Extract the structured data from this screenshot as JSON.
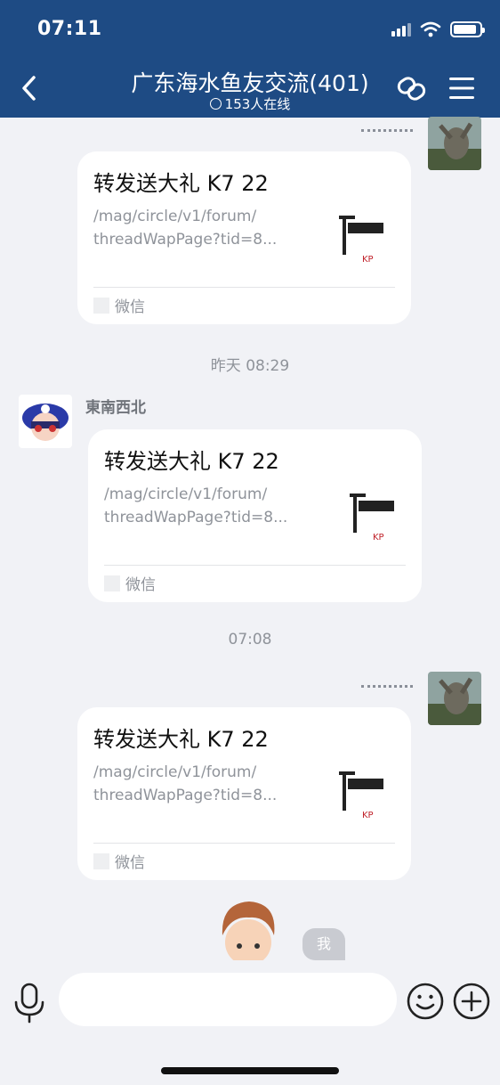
{
  "status_bar": {
    "time": "07:11"
  },
  "nav": {
    "title": "广东海水鱼友交流(401)",
    "online": "153人在线"
  },
  "messages": [
    {
      "title": "转发送大礼 K7 22",
      "desc_line1": "/mag/circle/v1/forum/",
      "desc_line2": "threadWapPage?tid=8...",
      "source": "微信"
    },
    {
      "time": "昨天 08:29",
      "sender": "東南西北",
      "title": "转发送大礼 K7 22",
      "desc_line1": "/mag/circle/v1/forum/",
      "desc_line2": "threadWapPage?tid=8...",
      "source": "微信"
    },
    {
      "time": "07:08",
      "title": "转发送大礼 K7 22",
      "desc_line1": "/mag/circle/v1/forum/",
      "desc_line2": "threadWapPage?tid=8...",
      "source": "微信"
    }
  ],
  "me_label": "我",
  "input": {
    "value": "",
    "placeholder": ""
  },
  "colors": {
    "nav_bg": "#1e4b84",
    "page_bg": "#f1f2f6",
    "card_bg": "#ffffff",
    "muted_text": "#8f939a"
  }
}
